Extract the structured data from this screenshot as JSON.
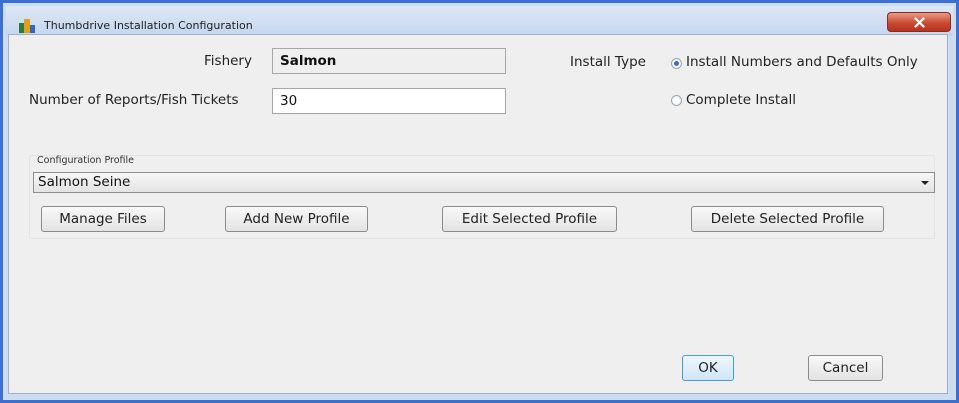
{
  "window": {
    "title": "Thumbdrive Installation Configuration"
  },
  "form": {
    "fishery_label": "Fishery",
    "fishery_value": "Salmon",
    "reports_label": "Number of Reports/Fish Tickets",
    "reports_value": "30",
    "install_type_label": "Install Type",
    "install_options": [
      {
        "label": "Install Numbers and Defaults Only",
        "selected": true
      },
      {
        "label": "Complete Install",
        "selected": false
      }
    ]
  },
  "profile": {
    "label": "Configuration Profile",
    "selected": "Salmon Seine",
    "buttons": {
      "manage": "Manage Files",
      "add": "Add New Profile",
      "edit": "Edit Selected Profile",
      "delete": "Delete Selected Profile"
    }
  },
  "footer": {
    "ok": "OK",
    "cancel": "Cancel"
  },
  "colors": {
    "frame": "#3b6fd1",
    "close": "#c94a33",
    "radio_selected": "#3e6db8"
  },
  "icons": {
    "app": "app-icon",
    "close": "close-icon",
    "dropdown": "chevron-down-icon"
  }
}
